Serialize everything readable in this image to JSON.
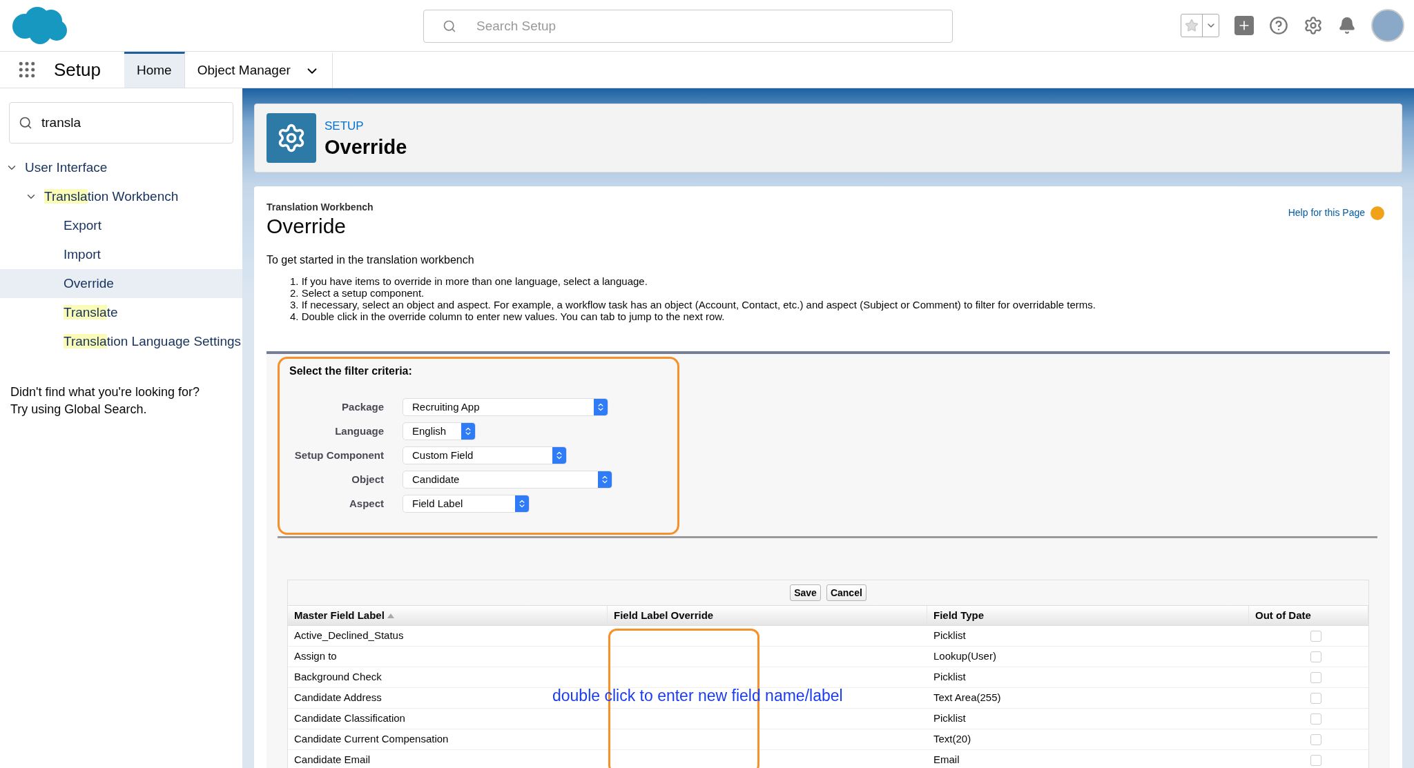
{
  "top_bar": {
    "search": {
      "placeholder": "Search Setup"
    }
  },
  "nav": {
    "app_name": "Setup",
    "tabs": [
      {
        "label": "Home",
        "selected": true,
        "has_menu": false
      },
      {
        "label": "Object Manager",
        "selected": false,
        "has_menu": true
      }
    ]
  },
  "sidebar": {
    "search": {
      "value": "transla"
    },
    "tree": [
      {
        "label": "User Interface",
        "expanded": true,
        "selected": false,
        "children": [
          {
            "highlighted": "Transla",
            "label": "tion Workbench",
            "expanded": true,
            "selected": false,
            "children": [
              {
                "label": "Export",
                "selected": false
              },
              {
                "label": "Import",
                "selected": false
              },
              {
                "label": "Override",
                "selected": true
              },
              {
                "highlighted": "Transla",
                "label": "te",
                "selected": false
              },
              {
                "highlighted": "Transla",
                "label": "tion Language Settings",
                "selected": false
              }
            ]
          }
        ]
      }
    ],
    "footer": [
      "Didn't find what you're looking for?",
      "Try using Global Search."
    ]
  },
  "header": {
    "eyebrow": "SETUP",
    "title": "Override"
  },
  "page": {
    "breadcrumb": "Translation Workbench",
    "title": "Override",
    "help_link": "Help for this Page",
    "intro": "To get started in the translation workbench",
    "steps": [
      "1. If you have items to override in more than one language, select a language.",
      "2. Select a setup component.",
      "3. If necessary, select an object and aspect. For example, a workflow task has an object (Account, Contact, etc.) and aspect (Subject or Comment) to filter for overridable terms.",
      "4. Double click in the override column to enter new values. You can tab to jump to the next row."
    ]
  },
  "filter": {
    "title": "Select the filter criteria:",
    "fields": [
      {
        "label": "Package",
        "value": "Recruiting App"
      },
      {
        "label": "Language",
        "value": "English"
      },
      {
        "label": "Setup Component",
        "value": "Custom Field"
      },
      {
        "label": "Object",
        "value": "Candidate"
      },
      {
        "label": "Aspect",
        "value": "Field Label"
      }
    ]
  },
  "table": {
    "buttons": [
      "Save",
      "Cancel"
    ],
    "columns": [
      {
        "label": "Master Field Label",
        "sorted": true
      },
      {
        "label": "Field Label Override",
        "sorted": false
      },
      {
        "label": "Field Type",
        "sorted": false
      },
      {
        "label": "Out of Date",
        "sorted": false
      }
    ],
    "rows": [
      {
        "label": "Active_Declined_Status",
        "type": "Picklist",
        "out_of_date": false
      },
      {
        "label": "Assign to",
        "type": "Lookup(User)",
        "out_of_date": false
      },
      {
        "label": "Background Check",
        "type": "Picklist",
        "out_of_date": false
      },
      {
        "label": "Candidate Address",
        "type": "Text Area(255)",
        "out_of_date": false
      },
      {
        "label": "Candidate Classification",
        "type": "Picklist",
        "out_of_date": false
      },
      {
        "label": "Candidate Current Compensation",
        "type": "Text(20)",
        "out_of_date": false
      },
      {
        "label": "Candidate Email",
        "type": "Email",
        "out_of_date": false
      }
    ]
  },
  "annotation": {
    "text": "double click to enter new field name/label"
  }
}
